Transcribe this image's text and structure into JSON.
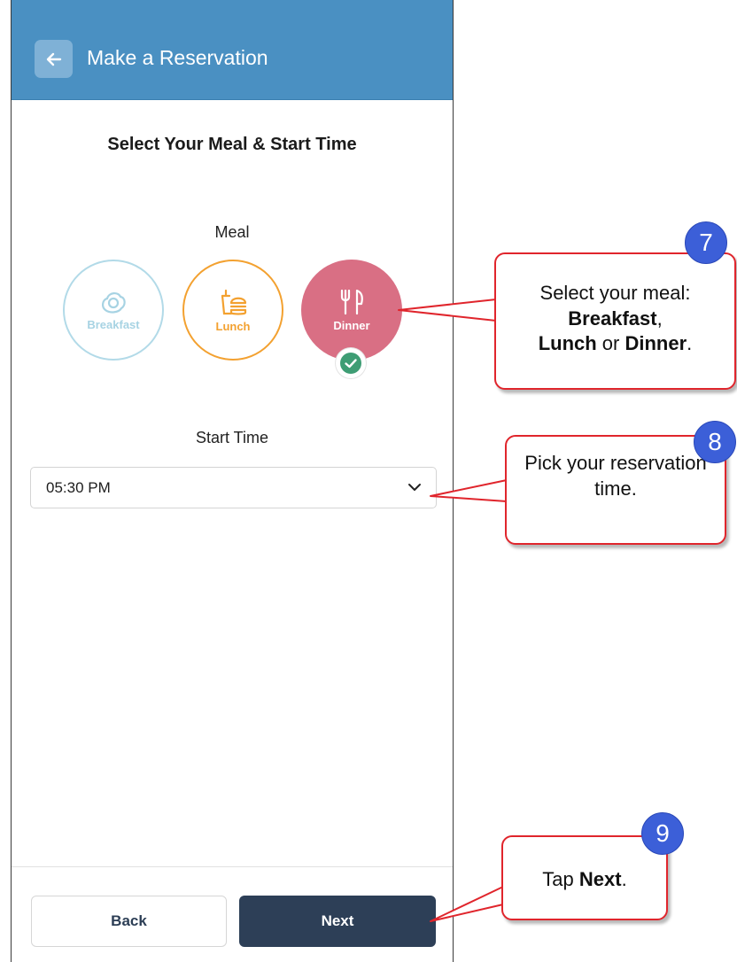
{
  "header": {
    "title": "Make a Reservation",
    "back_icon": "arrow-left-icon"
  },
  "page": {
    "title": "Select Your Meal & Start Time"
  },
  "meal": {
    "label": "Meal",
    "options": [
      {
        "label": "Breakfast",
        "icon": "egg-icon",
        "color": "#a7d3e3",
        "selected": false
      },
      {
        "label": "Lunch",
        "icon": "burger-icon",
        "color": "#f3a130",
        "selected": false
      },
      {
        "label": "Dinner",
        "icon": "fork-knife-icon",
        "color": "#d96f84",
        "selected": true
      }
    ]
  },
  "start_time": {
    "label": "Start Time",
    "value": "05:30 PM"
  },
  "footer": {
    "back_label": "Back",
    "next_label": "Next"
  },
  "callouts": [
    {
      "number": "7",
      "lines": [
        "Select your meal:",
        "Breakfast",
        ",",
        "Lunch",
        " or ",
        "Dinner",
        "."
      ]
    },
    {
      "number": "8",
      "text": "Pick your reservation time."
    },
    {
      "number": "9",
      "prefix": "Tap ",
      "bold": "Next",
      "suffix": "."
    }
  ],
  "colors": {
    "header": "#4a90c2",
    "next_button": "#2d3f57",
    "callout_border": "#e0252c",
    "badge": "#3c5fd8"
  }
}
